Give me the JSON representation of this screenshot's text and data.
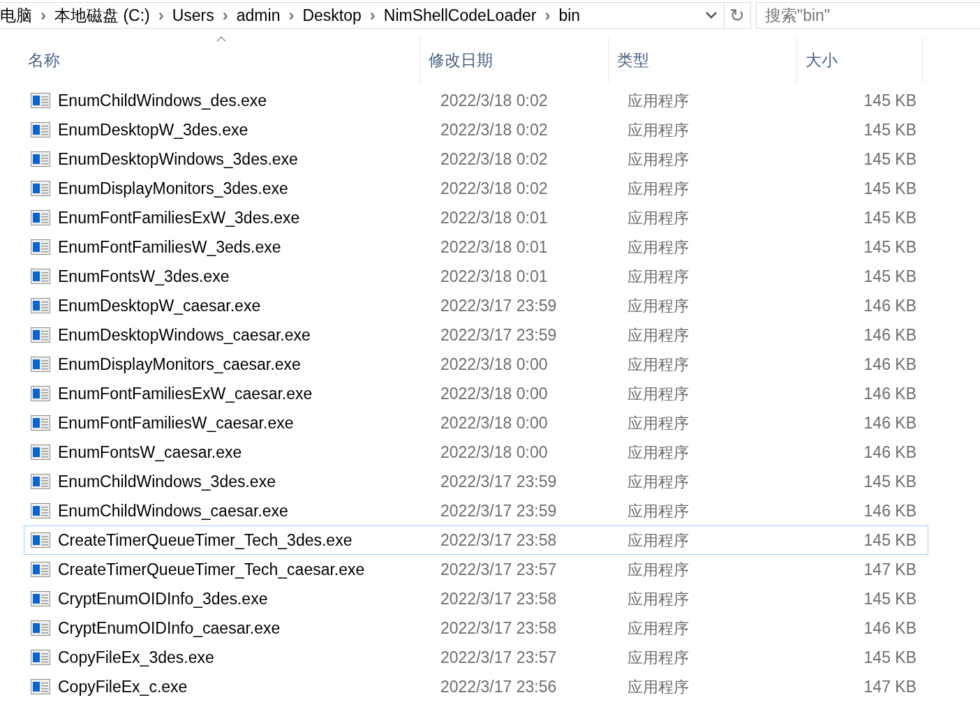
{
  "address_bar": {
    "path": [
      "电脑",
      "本地磁盘 (C:)",
      "Users",
      "admin",
      "Desktop",
      "NimShellCodeLoader",
      "bin"
    ],
    "separator": "›",
    "refresh": "↻"
  },
  "search": {
    "placeholder": "搜索\"bin\""
  },
  "table": {
    "columns": [
      {
        "label": "名称",
        "sorted": true
      },
      {
        "label": "修改日期",
        "sorted": false
      },
      {
        "label": "类型",
        "sorted": false
      },
      {
        "label": "大小",
        "sorted": false
      }
    ],
    "rows": [
      {
        "name": "EnumChildWindows_des.exe",
        "date": "2022/3/18 0:02",
        "type": "应用程序",
        "size": "145 KB",
        "focused": false
      },
      {
        "name": "EnumDesktopW_3des.exe",
        "date": "2022/3/18 0:02",
        "type": "应用程序",
        "size": "145 KB",
        "focused": false
      },
      {
        "name": "EnumDesktopWindows_3des.exe",
        "date": "2022/3/18 0:02",
        "type": "应用程序",
        "size": "145 KB",
        "focused": false
      },
      {
        "name": "EnumDisplayMonitors_3des.exe",
        "date": "2022/3/18 0:02",
        "type": "应用程序",
        "size": "145 KB",
        "focused": false
      },
      {
        "name": "EnumFontFamiliesExW_3des.exe",
        "date": "2022/3/18 0:01",
        "type": "应用程序",
        "size": "145 KB",
        "focused": false
      },
      {
        "name": "EnumFontFamiliesW_3eds.exe",
        "date": "2022/3/18 0:01",
        "type": "应用程序",
        "size": "145 KB",
        "focused": false
      },
      {
        "name": "EnumFontsW_3des.exe",
        "date": "2022/3/18 0:01",
        "type": "应用程序",
        "size": "145 KB",
        "focused": false
      },
      {
        "name": "EnumDesktopW_caesar.exe",
        "date": "2022/3/17 23:59",
        "type": "应用程序",
        "size": "146 KB",
        "focused": false
      },
      {
        "name": "EnumDesktopWindows_caesar.exe",
        "date": "2022/3/17 23:59",
        "type": "应用程序",
        "size": "146 KB",
        "focused": false
      },
      {
        "name": "EnumDisplayMonitors_caesar.exe",
        "date": "2022/3/18 0:00",
        "type": "应用程序",
        "size": "146 KB",
        "focused": false
      },
      {
        "name": "EnumFontFamiliesExW_caesar.exe",
        "date": "2022/3/18 0:00",
        "type": "应用程序",
        "size": "146 KB",
        "focused": false
      },
      {
        "name": "EnumFontFamiliesW_caesar.exe",
        "date": "2022/3/18 0:00",
        "type": "应用程序",
        "size": "146 KB",
        "focused": false
      },
      {
        "name": "EnumFontsW_caesar.exe",
        "date": "2022/3/18 0:00",
        "type": "应用程序",
        "size": "146 KB",
        "focused": false
      },
      {
        "name": "EnumChildWindows_3des.exe",
        "date": "2022/3/17 23:59",
        "type": "应用程序",
        "size": "145 KB",
        "focused": false
      },
      {
        "name": "EnumChildWindows_caesar.exe",
        "date": "2022/3/17 23:59",
        "type": "应用程序",
        "size": "146 KB",
        "focused": false
      },
      {
        "name": "CreateTimerQueueTimer_Tech_3des.exe",
        "date": "2022/3/17 23:58",
        "type": "应用程序",
        "size": "145 KB",
        "focused": true
      },
      {
        "name": "CreateTimerQueueTimer_Tech_caesar.exe",
        "date": "2022/3/17 23:57",
        "type": "应用程序",
        "size": "147 KB",
        "focused": false
      },
      {
        "name": "CryptEnumOIDInfo_3des.exe",
        "date": "2022/3/17 23:58",
        "type": "应用程序",
        "size": "145 KB",
        "focused": false
      },
      {
        "name": "CryptEnumOIDInfo_caesar.exe",
        "date": "2022/3/17 23:58",
        "type": "应用程序",
        "size": "146 KB",
        "focused": false
      },
      {
        "name": "CopyFileEx_3des.exe",
        "date": "2022/3/17 23:57",
        "type": "应用程序",
        "size": "145 KB",
        "focused": false
      },
      {
        "name": "CopyFileEx_c.exe",
        "date": "2022/3/17 23:56",
        "type": "应用程序",
        "size": "147 KB",
        "focused": false
      }
    ]
  }
}
